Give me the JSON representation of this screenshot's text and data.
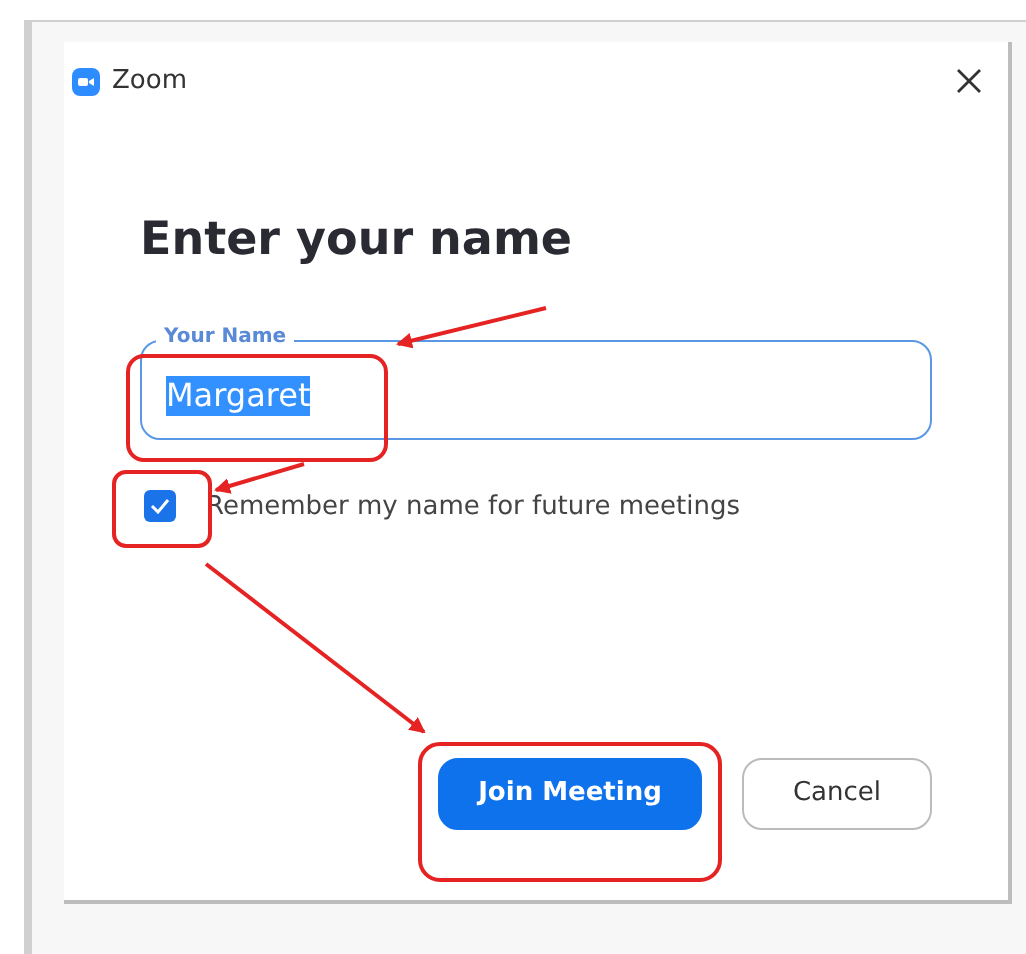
{
  "window": {
    "title": "Zoom"
  },
  "heading": "Enter your name",
  "name_field": {
    "label": "Your Name",
    "value": "Margaret",
    "value_selected": true
  },
  "remember": {
    "label": "Remember my name for future meetings",
    "checked": true
  },
  "buttons": [
    {
      "label": "Join Meeting",
      "kind": "primary"
    },
    {
      "label": "Cancel",
      "kind": "secondary"
    }
  ]
}
